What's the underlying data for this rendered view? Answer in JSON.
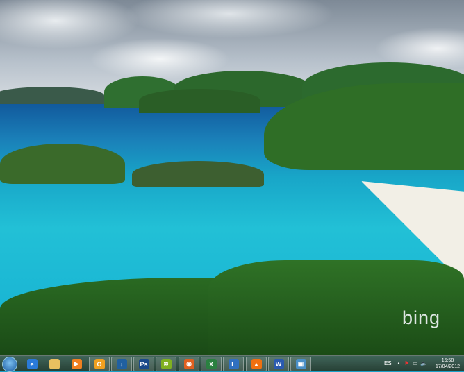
{
  "wallpaper": {
    "logo": "bing"
  },
  "taskbar": {
    "start": "windows-start-orb",
    "apps": [
      {
        "name": "internet-explorer",
        "color": "#2a7ad8",
        "glyph": "e"
      },
      {
        "name": "windows-explorer",
        "color": "#e8c060",
        "glyph": ""
      },
      {
        "name": "windows-media-player",
        "color": "#f08020",
        "glyph": "▶"
      },
      {
        "name": "outlook",
        "color": "#f0a020",
        "glyph": "O"
      },
      {
        "name": "download-manager",
        "color": "#2060a0",
        "glyph": "↓"
      },
      {
        "name": "photoshop",
        "color": "#1a4a8a",
        "glyph": "Ps"
      },
      {
        "name": "spotify",
        "color": "#80b020",
        "glyph": "≋"
      },
      {
        "name": "firefox",
        "color": "#e06020",
        "glyph": "◉"
      },
      {
        "name": "excel",
        "color": "#2a8040",
        "glyph": "X"
      },
      {
        "name": "lync",
        "color": "#3070c0",
        "glyph": "L"
      },
      {
        "name": "vlc",
        "color": "#f07010",
        "glyph": "▲"
      },
      {
        "name": "word",
        "color": "#2a5ab0",
        "glyph": "W"
      },
      {
        "name": "remote-desktop",
        "color": "#4a90c8",
        "glyph": "▣"
      }
    ],
    "tray": {
      "language": "ES",
      "show_hidden": "▲",
      "action_center": "⚑",
      "network": "▭",
      "volume": "🔈"
    },
    "clock": {
      "time": "15:58",
      "date": "17/04/2012"
    }
  }
}
